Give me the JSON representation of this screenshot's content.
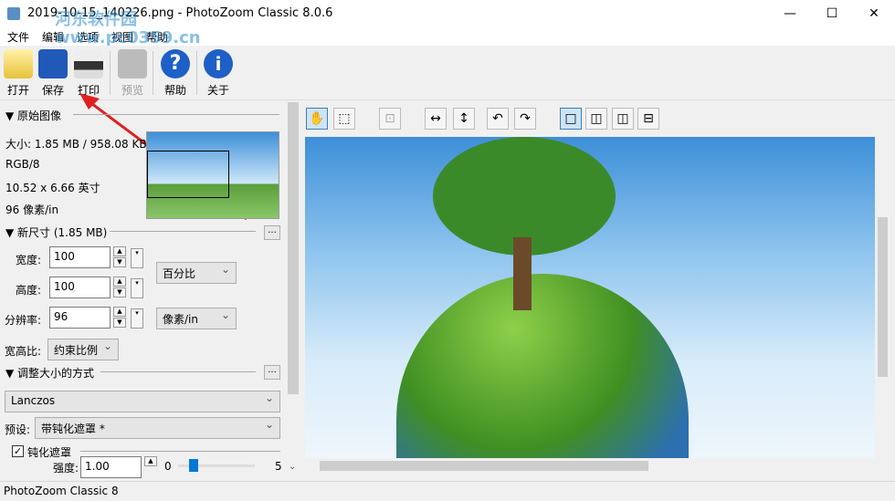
{
  "window": {
    "title": "2019-10-15_140226.png - PhotoZoom Classic 8.0.6",
    "minimize": "—",
    "maximize": "☐",
    "close": "✕"
  },
  "menu": [
    "文件",
    "编辑",
    "选项",
    "视图",
    "帮助"
  ],
  "toolbar": [
    {
      "label": "打开",
      "icon": "folder-icon"
    },
    {
      "label": "保存",
      "icon": "save-icon"
    },
    {
      "label": "打印",
      "icon": "printer-icon"
    },
    {
      "label": "预览",
      "icon": "preview-icon"
    },
    {
      "label": "帮助",
      "icon": "help-icon"
    },
    {
      "label": "关于",
      "icon": "info-icon"
    }
  ],
  "original": {
    "header": "原始图像",
    "size": "大小: 1.85 MB / 958.08 KB",
    "mode": "RGB/8",
    "dims": "10.52 x 6.66 英寸",
    "dpi": "96 像素/in"
  },
  "newsize": {
    "header": "新尺寸 (1.85 MB)",
    "more": "...",
    "width_label": "宽度:",
    "width": "100",
    "height_label": "高度:",
    "height": "100",
    "res_label": "分辨率:",
    "res": "96",
    "unit": "百分比",
    "res_unit": "像素/in",
    "aspect_label": "宽高比:",
    "aspect": "约束比例"
  },
  "resize": {
    "header": "调整大小的方式",
    "more": "...",
    "method": "Lanczos",
    "preset_label": "预设:",
    "preset": "带钝化遮罩 *",
    "unsharp_label": "钝化遮罩",
    "unsharp_checked": true,
    "strength_label": "强度:",
    "strength": "1.00",
    "slider_min": "0",
    "slider_max": "5",
    "slider_value": 1.0
  },
  "viewtools": [
    "✋",
    "⬚",
    "⊡",
    "↔",
    "↕",
    "↶",
    "↷",
    "□",
    "◫",
    "◫",
    "⊟"
  ],
  "status": "PhotoZoom Classic 8",
  "watermark": "河东软件园 www.pc0359.cn"
}
